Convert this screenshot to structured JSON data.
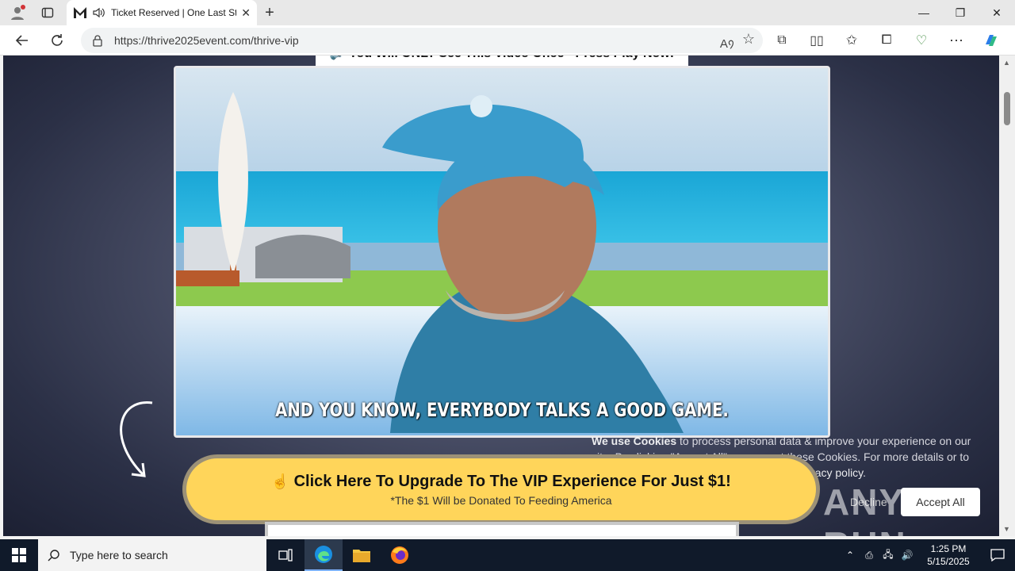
{
  "browser": {
    "tab": {
      "title": "Ticket Reserved | One Last St"
    },
    "address": {
      "url": "https://thrive2025event.com/thrive-vip"
    },
    "window_controls": {
      "minimize": "—",
      "restore": "❐",
      "close": "✕"
    }
  },
  "page": {
    "top_strip_text": "🔊 You Will ONLY See This Video Once - Press Play Now!",
    "video_caption": "AND YOU KNOW, EVERYBODY TALKS A GOOD GAME.",
    "cta": {
      "main": "Click Here To Upgrade To The VIP Experience For Just $1!",
      "sub": "*The $1 Will be Donated To Feeding America"
    },
    "cookie": {
      "title": "We use Cookies",
      "text": " to process personal data & improve your experience on our site. By clicking \"Accept All\" you accept these Cookies. For more details or to manage & select cookies, please see our ",
      "link": "privacy policy",
      "end": ".",
      "decline": "Decline",
      "accept": "Accept All"
    },
    "watermark": "ANY RUN"
  },
  "taskbar": {
    "search_placeholder": "Type here to search",
    "time": "1:25 PM",
    "date": "5/15/2025"
  },
  "colors": {
    "cta": "#ffd55a",
    "taskbar": "#101a2a",
    "accent": "#0078d4"
  }
}
